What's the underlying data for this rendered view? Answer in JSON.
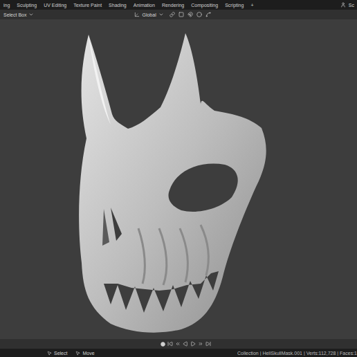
{
  "workspace_tabs": [
    {
      "label": "ing",
      "selected": false
    },
    {
      "label": "Sculpting",
      "selected": false
    },
    {
      "label": "UV Editing",
      "selected": false
    },
    {
      "label": "Texture Paint",
      "selected": false
    },
    {
      "label": "Shading",
      "selected": false
    },
    {
      "label": "Animation",
      "selected": false
    },
    {
      "label": "Rendering",
      "selected": false
    },
    {
      "label": "Compositing",
      "selected": false
    },
    {
      "label": "Scripting",
      "selected": false
    }
  ],
  "add_tab": "+",
  "scene_label": "Sc",
  "header": {
    "select_mode": "Select Box",
    "orientation": "Global"
  },
  "status_bar": {
    "hints": [
      {
        "label": "Select"
      },
      {
        "label": "Move"
      }
    ],
    "info": "Collection | HellSkullMask.001 | Verts:112,728 | Faces:1"
  }
}
